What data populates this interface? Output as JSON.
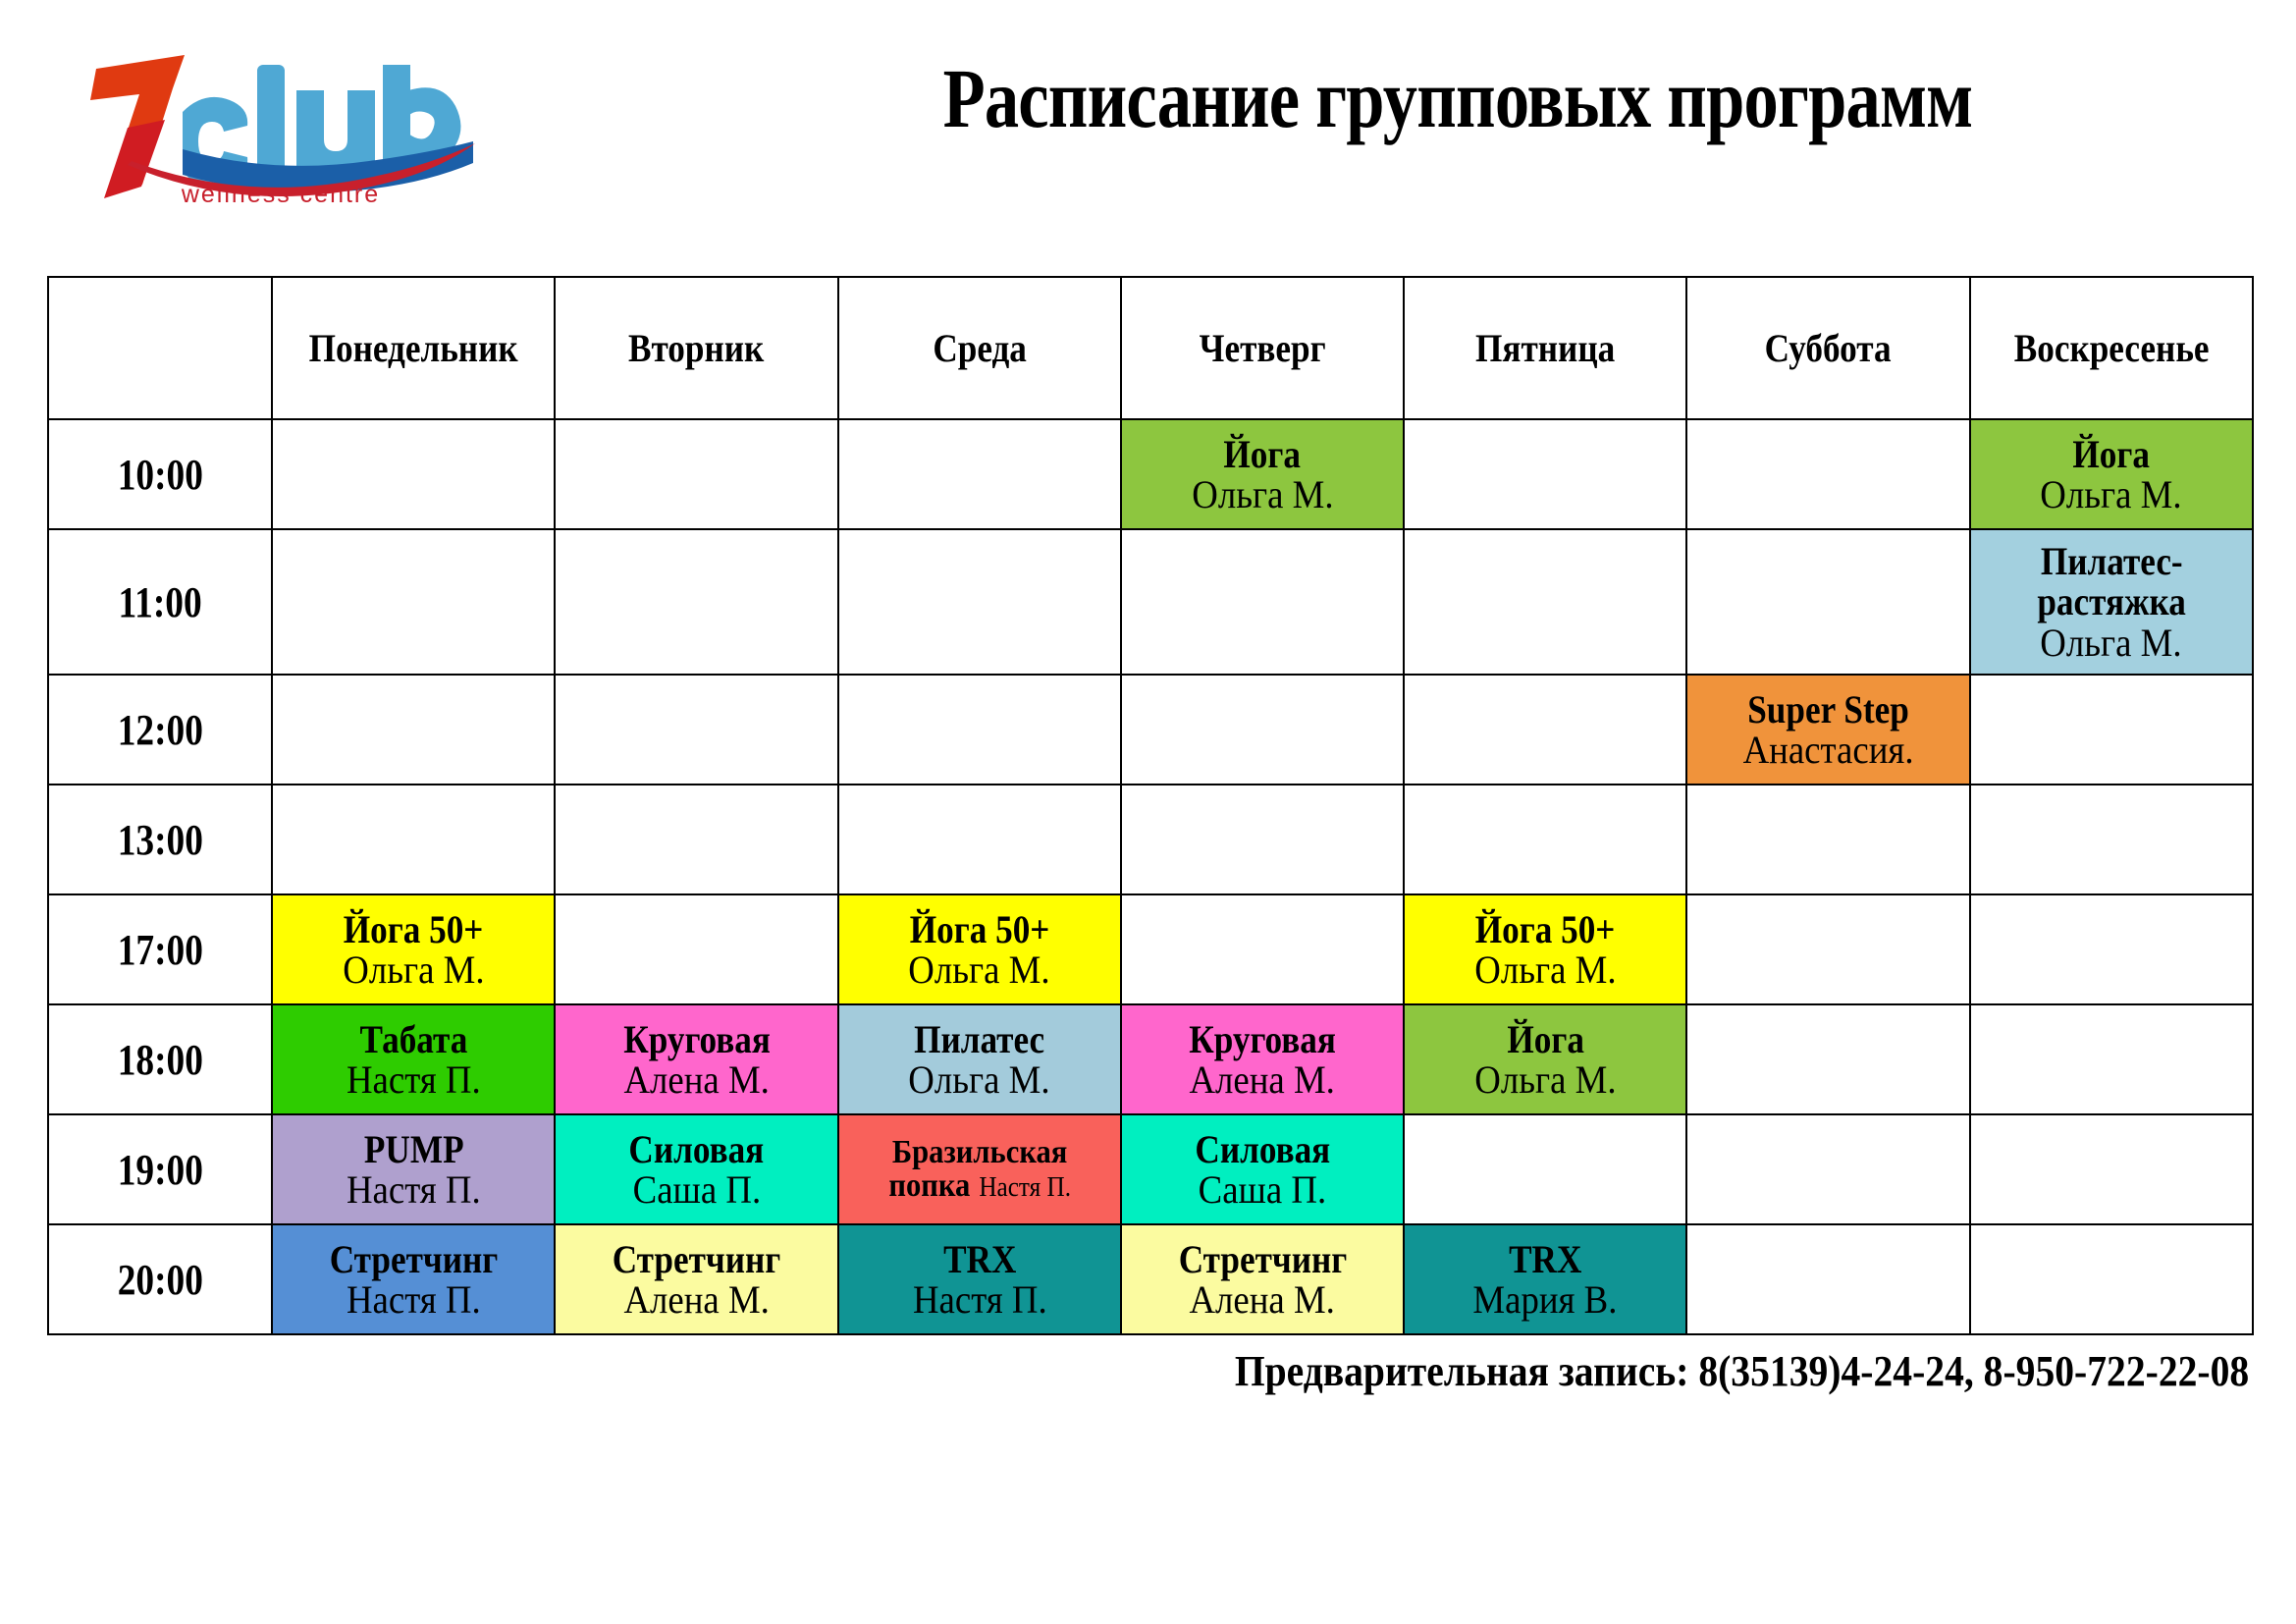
{
  "header": {
    "title": "Расписание групповых программ",
    "logo": {
      "mark": "7",
      "wordmark": "club",
      "tagline": "wellness centre",
      "colors": {
        "mark_red": "#E03A11",
        "mark_red_dark": "#D01C22",
        "club_blue": "#4FA8D4",
        "club_blue_dark": "#1B5FA8",
        "wave_red": "#C8202C",
        "tagline_red": "#C8202C"
      }
    }
  },
  "table": {
    "corner_label": "",
    "day_headers": [
      "Понедельник",
      "Вторник",
      "Среда",
      "Четверг",
      "Пятница",
      "Суббота",
      "Воскресенье"
    ],
    "times": [
      "10:00",
      "11:00",
      "12:00",
      "13:00",
      "17:00",
      "18:00",
      "19:00",
      "20:00"
    ],
    "palette": {
      "yoga_green": "#8DC63F",
      "pilates_stretch_blue": "#A3D0DF",
      "super_step_orange": "#F0933B",
      "yoga50_yellow": "#FFFF00",
      "tabata_green": "#2ECC00",
      "krugovaya_pink": "#FF66CC",
      "pilates_blue": "#A3CBDB",
      "pump_purple": "#AFA0CE",
      "silovaya_spring": "#00EFC0",
      "brazil_red": "#F9615B",
      "stretch_cornflower": "#558FD5",
      "stretch_lightyellow": "#FBFBA0",
      "trx_teal": "#109494"
    },
    "rows": [
      {
        "time": "10:00",
        "cells": [
          {},
          {},
          {},
          {
            "class_name": "Йога",
            "instructor": "Ольга М.",
            "color": "#8DC63F"
          },
          {},
          {},
          {
            "class_name": "Йога",
            "instructor": "Ольга М.",
            "color": "#8DC63F"
          }
        ]
      },
      {
        "time": "11:00",
        "cells": [
          {},
          {},
          {},
          {},
          {},
          {},
          {
            "class_name": "Пилатес-",
            "class_name2": "растяжка",
            "instructor": "Ольга М.",
            "color": "#A3D0DF",
            "layout": "stack3"
          }
        ]
      },
      {
        "time": "12:00",
        "cells": [
          {},
          {},
          {},
          {},
          {},
          {
            "class_name": "Super Step",
            "instructor": "Анастасия.",
            "color": "#F0933B"
          },
          {}
        ]
      },
      {
        "time": "13:00",
        "cells": [
          {},
          {},
          {},
          {},
          {},
          {},
          {}
        ]
      },
      {
        "time": "17:00",
        "cells": [
          {
            "class_name": "Йога 50+",
            "instructor": "Ольга М.",
            "color": "#FFFF00"
          },
          {},
          {
            "class_name": "Йога 50+",
            "instructor": "Ольга М.",
            "color": "#FFFF00"
          },
          {},
          {
            "class_name": "Йога 50+",
            "instructor": "Ольга М.",
            "color": "#FFFF00"
          },
          {},
          {}
        ]
      },
      {
        "time": "18:00",
        "cells": [
          {
            "class_name": "Табата",
            "instructor": "Настя П.",
            "color": "#2ECC00"
          },
          {
            "class_name": "Круговая",
            "instructor": "Алена М.",
            "color": "#FF66CC"
          },
          {
            "class_name": "Пилатес",
            "instructor": "Ольга М.",
            "color": "#A3CBDB"
          },
          {
            "class_name": "Круговая",
            "instructor": "Алена М.",
            "color": "#FF66CC"
          },
          {
            "class_name": "Йога",
            "instructor": "Ольга М.",
            "color": "#8DC63F"
          },
          {},
          {}
        ]
      },
      {
        "time": "19:00",
        "cells": [
          {
            "class_name": "PUMP",
            "instructor": "Настя П.",
            "color": "#AFA0CE"
          },
          {
            "class_name": "Силовая",
            "instructor": "Саша П.",
            "color": "#00EFC0"
          },
          {
            "class_name": "Бразильская",
            "class_name2": "попка",
            "instructor": "Настя П.",
            "color": "#F9615B",
            "layout": "wrap2"
          },
          {
            "class_name": "Силовая",
            "instructor": "Саша П.",
            "color": "#00EFC0"
          },
          {},
          {},
          {}
        ]
      },
      {
        "time": "20:00",
        "cells": [
          {
            "class_name": "Стретчинг",
            "instructor": "Настя П.",
            "color": "#558FD5"
          },
          {
            "class_name": "Стретчинг",
            "instructor": "Алена М.",
            "color": "#FBFBA0"
          },
          {
            "class_name": "TRX",
            "instructor": "Настя П.",
            "color": "#109494"
          },
          {
            "class_name": "Стретчинг",
            "instructor": "Алена М.",
            "color": "#FBFBA0"
          },
          {
            "class_name": "TRX",
            "instructor": "Мария В.",
            "color": "#109494"
          },
          {},
          {}
        ]
      }
    ]
  },
  "footer": {
    "booking_note": "Предварительная запись: 8(35139)4-24-24, 8-950-722-22-08"
  }
}
